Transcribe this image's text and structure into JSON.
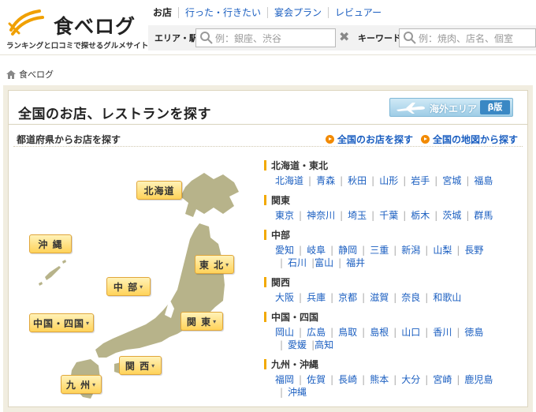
{
  "header": {
    "logo_text": "食べログ",
    "tagline": "ランキングと口コミで探せるグルメサイト",
    "nav": [
      "お店",
      "行った・行きたい",
      "宴会プラン",
      "レビュアー"
    ],
    "area_label": "エリア・駅",
    "area_placeholder": "例：銀座、渋谷",
    "keyword_label": "キーワード",
    "keyword_placeholder": "例：焼肉、店名、個室",
    "clear_glyph": "✖"
  },
  "breadcrumb": {
    "home": "食べログ"
  },
  "main": {
    "title": "全国のお店、レストランを探す",
    "intl_button": "海外エリア",
    "intl_badge": "β版",
    "subhead": "都道府県からお店を探す",
    "links": [
      "全国のお店を探す",
      "全国の地図から探す"
    ]
  },
  "map_buttons": {
    "hokkaido": "北海道",
    "okinawa": "沖 縄",
    "tohoku": "東 北",
    "chubu": "中 部",
    "chugoku_shikoku": "中国・四国",
    "kanto": "関 東",
    "kansai": "関 西",
    "kyushu": "九 州",
    "caret": "▾"
  },
  "regions": [
    {
      "name": "北海道・東北",
      "prefs": [
        "北海道",
        "青森",
        "秋田",
        "山形",
        "岩手",
        "宮城",
        "福島"
      ]
    },
    {
      "name": "関東",
      "prefs": [
        "東京",
        "神奈川",
        "埼玉",
        "千葉",
        "栃木",
        "茨城",
        "群馬"
      ]
    },
    {
      "name": "中部",
      "prefs": [
        "愛知",
        "岐阜",
        "静岡",
        "三重",
        "新潟",
        "山梨",
        "長野",
        "石川",
        "富山",
        "福井"
      ]
    },
    {
      "name": "関西",
      "prefs": [
        "大阪",
        "兵庫",
        "京都",
        "滋賀",
        "奈良",
        "和歌山"
      ]
    },
    {
      "name": "中国・四国",
      "prefs": [
        "岡山",
        "広島",
        "鳥取",
        "島根",
        "山口",
        "香川",
        "徳島",
        "愛媛",
        "高知"
      ]
    },
    {
      "name": "九州・沖縄",
      "prefs": [
        "福岡",
        "佐賀",
        "長崎",
        "熊本",
        "大分",
        "宮崎",
        "鹿児島",
        "沖縄"
      ]
    }
  ],
  "colors": {
    "link": "#1a5ec0",
    "accent": "#f28a00",
    "map_land": "#b7b38a",
    "panel_bg": "#f1ede0",
    "button_gold": "#ffd35a"
  }
}
